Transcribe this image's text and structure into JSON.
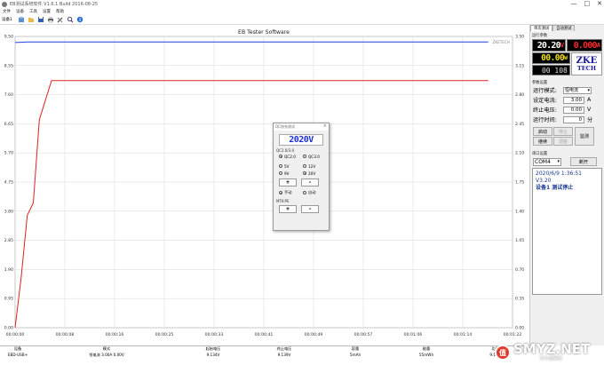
{
  "window": {
    "title": "EB测试系统软件 V1.6.1 Build 2016-08-25",
    "minimize": "—",
    "maximize": "□",
    "close": "✕"
  },
  "menu": [
    "文件",
    "设备",
    "工具",
    "设置",
    "帮助"
  ],
  "toolbar": {
    "device_label": "设备1",
    "icons": [
      "connect-icon",
      "open-icon",
      "save-icon",
      "print-icon",
      "tools-icon",
      "zoom-icon",
      "info-icon"
    ]
  },
  "chart_data": {
    "type": "line",
    "title": "EB Tester Software",
    "watermark": "ZKETECH",
    "x_ticks": [
      "00:00:00",
      "00:00:08",
      "00:00:16",
      "00:00:25",
      "00:00:33",
      "00:00:41",
      "00:00:49",
      "00:00:57",
      "00:01:06",
      "00:01:14",
      "00:01:22"
    ],
    "x_range_seconds": [
      0,
      82
    ],
    "y_left": {
      "ticks": [
        "9.50",
        "8.55",
        "7.60",
        "6.65",
        "5.70",
        "4.75",
        "3.80",
        "2.85",
        "1.90",
        "0.95",
        "0.00"
      ],
      "range": [
        0,
        9.5
      ]
    },
    "y_right": {
      "ticks": [
        "3.50",
        "3.15",
        "2.80",
        "2.45",
        "2.10",
        "1.75",
        "1.40",
        "1.05",
        "0.70",
        "0.35",
        "0.00"
      ],
      "range": [
        0,
        3.5
      ]
    },
    "series": [
      {
        "color": "#1f3fe0",
        "axis": "left",
        "x": [
          0,
          1,
          2,
          6,
          12,
          20,
          30,
          40,
          50,
          60,
          70,
          78
        ],
        "y": [
          9.3,
          9.31,
          9.32,
          9.32,
          9.32,
          9.32,
          9.32,
          9.32,
          9.32,
          9.32,
          9.32,
          9.32
        ]
      },
      {
        "color": "#e02020",
        "axis": "right",
        "x": [
          0,
          1,
          2,
          3,
          4,
          6,
          12,
          20,
          30,
          40,
          50,
          60,
          70,
          78
        ],
        "y": [
          0,
          0.6,
          1.35,
          1.5,
          2.5,
          2.97,
          2.97,
          2.97,
          2.97,
          2.97,
          2.97,
          2.97,
          2.97,
          2.97
        ]
      }
    ],
    "grid": true
  },
  "table": {
    "headers": [
      "设备",
      "模式",
      "起始电压",
      "终止电压",
      "容量",
      "能量",
      "功率"
    ],
    "row": [
      "EBD-USB+",
      "恒电流 3.00A 0.00V",
      "9.134V",
      "9.139V",
      "5mAh",
      "55mWh",
      "9.14V"
    ]
  },
  "side": {
    "tabs": [
      "单次测试",
      "自动测试"
    ],
    "run_params_label": "运行参数",
    "voltage": "20.20",
    "voltage_unit": "V",
    "current": "0.000",
    "current_unit": "A",
    "power": "00.00",
    "power_unit": "W",
    "time": "00 108",
    "logo_top": "ZKE",
    "logo_bottom": "TECH",
    "settings_label": "参数设置",
    "mode_label": "运行模式:",
    "mode_value": "恒电流",
    "set_current_label": "设定电流:",
    "set_current_value": "3.00",
    "set_current_unit": "A",
    "cutoff_label": "终止电压:",
    "cutoff_value": "0.00",
    "cutoff_unit": "V",
    "runtime_label": "运行时间:",
    "runtime_value": "0",
    "runtime_unit": "分",
    "btn_start": "启动",
    "btn_stop": "停止",
    "btn_continue": "继续",
    "btn_adjust": "调整",
    "btn_monitor": "监测",
    "port_label": "串口设置",
    "port_value": "COM4",
    "btn_open": "断开",
    "status_line1": "2020/6/9  1:36:51  V3.20",
    "status_line2": "设备1  测试停止"
  },
  "dialog": {
    "title": "QC快充测试",
    "lcd": "2020V",
    "qc_label": "QC2.0/3.0",
    "qc20": "QC2.0",
    "qc30": "QC3.0",
    "v5": "5V",
    "v12": "12V",
    "v9": "9V",
    "v20": "20V",
    "plus": "+",
    "minus": "-",
    "manual": "手动",
    "auto": "自动",
    "mtk_label": "MTK-PE",
    "plus2": "+",
    "minus2": "-"
  },
  "watermark": {
    "text": "SMYZ.NET",
    "sub": "什么值得买"
  }
}
